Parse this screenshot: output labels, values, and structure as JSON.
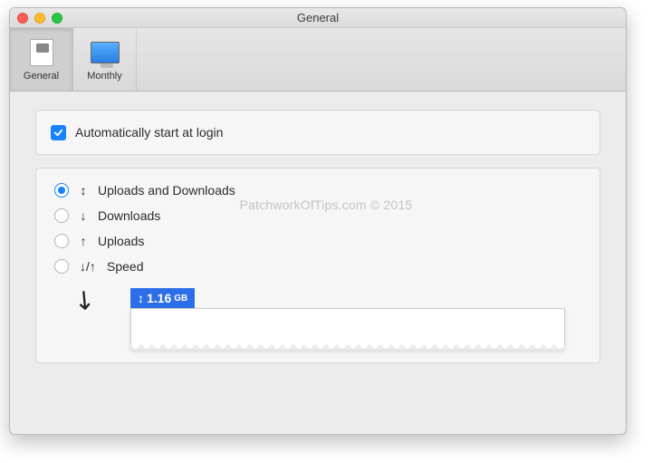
{
  "window": {
    "title": "General"
  },
  "tabs": [
    {
      "label": "General",
      "active": true
    },
    {
      "label": "Monthly",
      "active": false
    }
  ],
  "autostart": {
    "checked": true,
    "label": "Automatically start at login"
  },
  "display_mode": {
    "selected": 0,
    "options": [
      {
        "glyph": "↕",
        "label": "Uploads and Downloads"
      },
      {
        "glyph": "↓",
        "label": "Downloads"
      },
      {
        "glyph": "↑",
        "label": "Uploads"
      },
      {
        "glyph": "↓/↑",
        "label": "Speed"
      }
    ]
  },
  "preview": {
    "glyph": "↕",
    "value": "1.16",
    "unit": "GB"
  },
  "watermark": "PatchworkOfTips.com © 2015"
}
